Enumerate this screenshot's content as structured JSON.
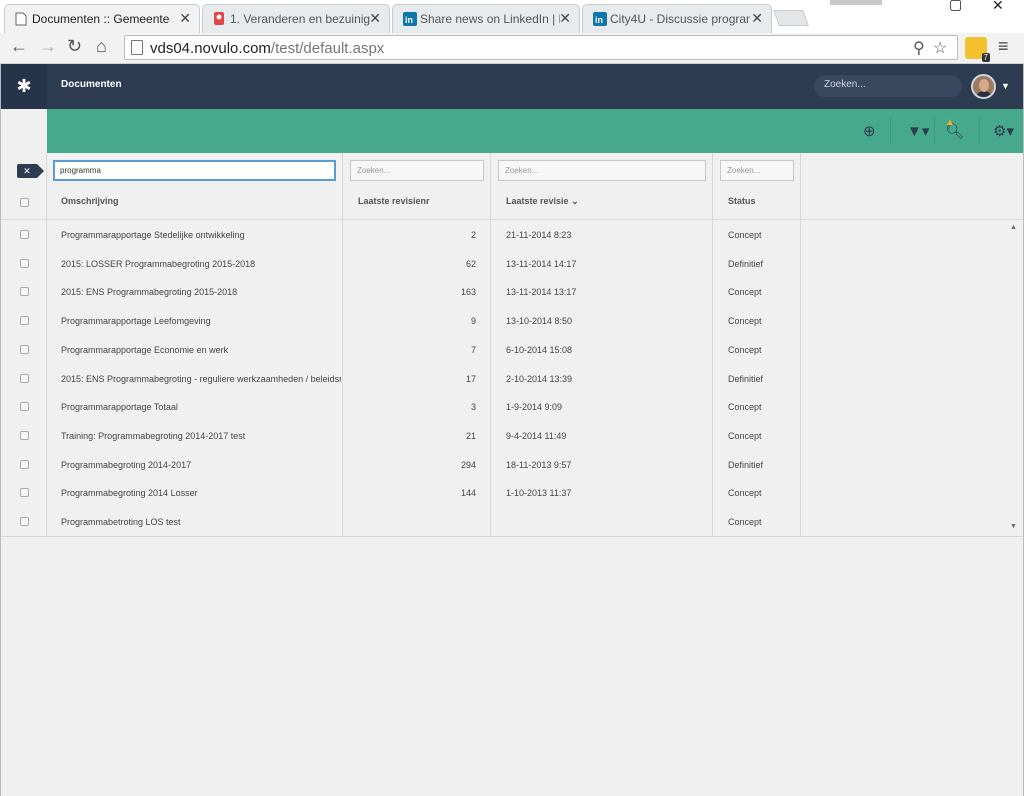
{
  "browser": {
    "tabs": [
      {
        "title": "Documenten :: Gemeente",
        "icon": "page-icon",
        "close": "✕",
        "active": true
      },
      {
        "title": "1. Veranderen en bezuinig",
        "icon": "bookmark-icon",
        "close": "✕",
        "active": false
      },
      {
        "title": "Share news on LinkedIn | L",
        "icon": "linkedin-icon",
        "close": "✕",
        "active": false
      },
      {
        "title": "City4U - Discussie progran",
        "icon": "linkedin-icon",
        "close": "✕",
        "active": false
      }
    ],
    "url_host": "vds04.novulo.com",
    "url_path": "/test/default.aspx",
    "extension_badge": "7"
  },
  "app": {
    "title": "Documenten",
    "search_placeholder": "Zoeken..."
  },
  "grid": {
    "filters": {
      "omschrijving": "programma",
      "revisienr_placeholder": "Zoeken...",
      "revisie_placeholder": "Zoeken...",
      "status_placeholder": "Zoeken..."
    },
    "columns": {
      "omschrijving": "Omschrijving",
      "revisienr": "Laatste revisienr",
      "revisie": "Laatste revisie",
      "status": "Status"
    },
    "sort_indicator": "⌄",
    "rows": [
      {
        "omschrijving": "Programmarapportage Stedelijke ontwikkeling",
        "revisienr": "2",
        "revisie": "21-11-2014 8:23",
        "status": "Concept"
      },
      {
        "omschrijving": "2015: LOSSER Programmabegroting 2015-2018",
        "revisienr": "62",
        "revisie": "13-11-2014 14:17",
        "status": "Definitief"
      },
      {
        "omschrijving": "2015: ENS Programmabegroting 2015-2018",
        "revisienr": "163",
        "revisie": "13-11-2014 13:17",
        "status": "Concept"
      },
      {
        "omschrijving": "Programmarapportage Leefomgeving",
        "revisienr": "9",
        "revisie": "13-10-2014 8:50",
        "status": "Concept"
      },
      {
        "omschrijving": "Programmarapportage Economie en werk",
        "revisienr": "7",
        "revisie": "6-10-2014 15:08",
        "status": "Concept"
      },
      {
        "omschrijving": "2015: ENS Programmabegroting - reguliere werkzaamheden / beleidsr",
        "revisienr": "17",
        "revisie": "2-10-2014 13:39",
        "status": "Definitief"
      },
      {
        "omschrijving": "Programmarapportage Totaal",
        "revisienr": "3",
        "revisie": "1-9-2014 9:09",
        "status": "Concept"
      },
      {
        "omschrijving": "Training: Programmabegroting 2014-2017 test",
        "revisienr": "21",
        "revisie": "9-4-2014 11:49",
        "status": "Concept"
      },
      {
        "omschrijving": "Programmabegroting 2014-2017",
        "revisienr": "294",
        "revisie": "18-11-2013 9:57",
        "status": "Definitief"
      },
      {
        "omschrijving": "Programmabegroting 2014 Losser",
        "revisienr": "144",
        "revisie": "1-10-2013 11:37",
        "status": "Concept"
      },
      {
        "omschrijving": "Programmabetroting LOS test",
        "revisienr": "",
        "revisie": "",
        "status": "Concept"
      }
    ]
  }
}
